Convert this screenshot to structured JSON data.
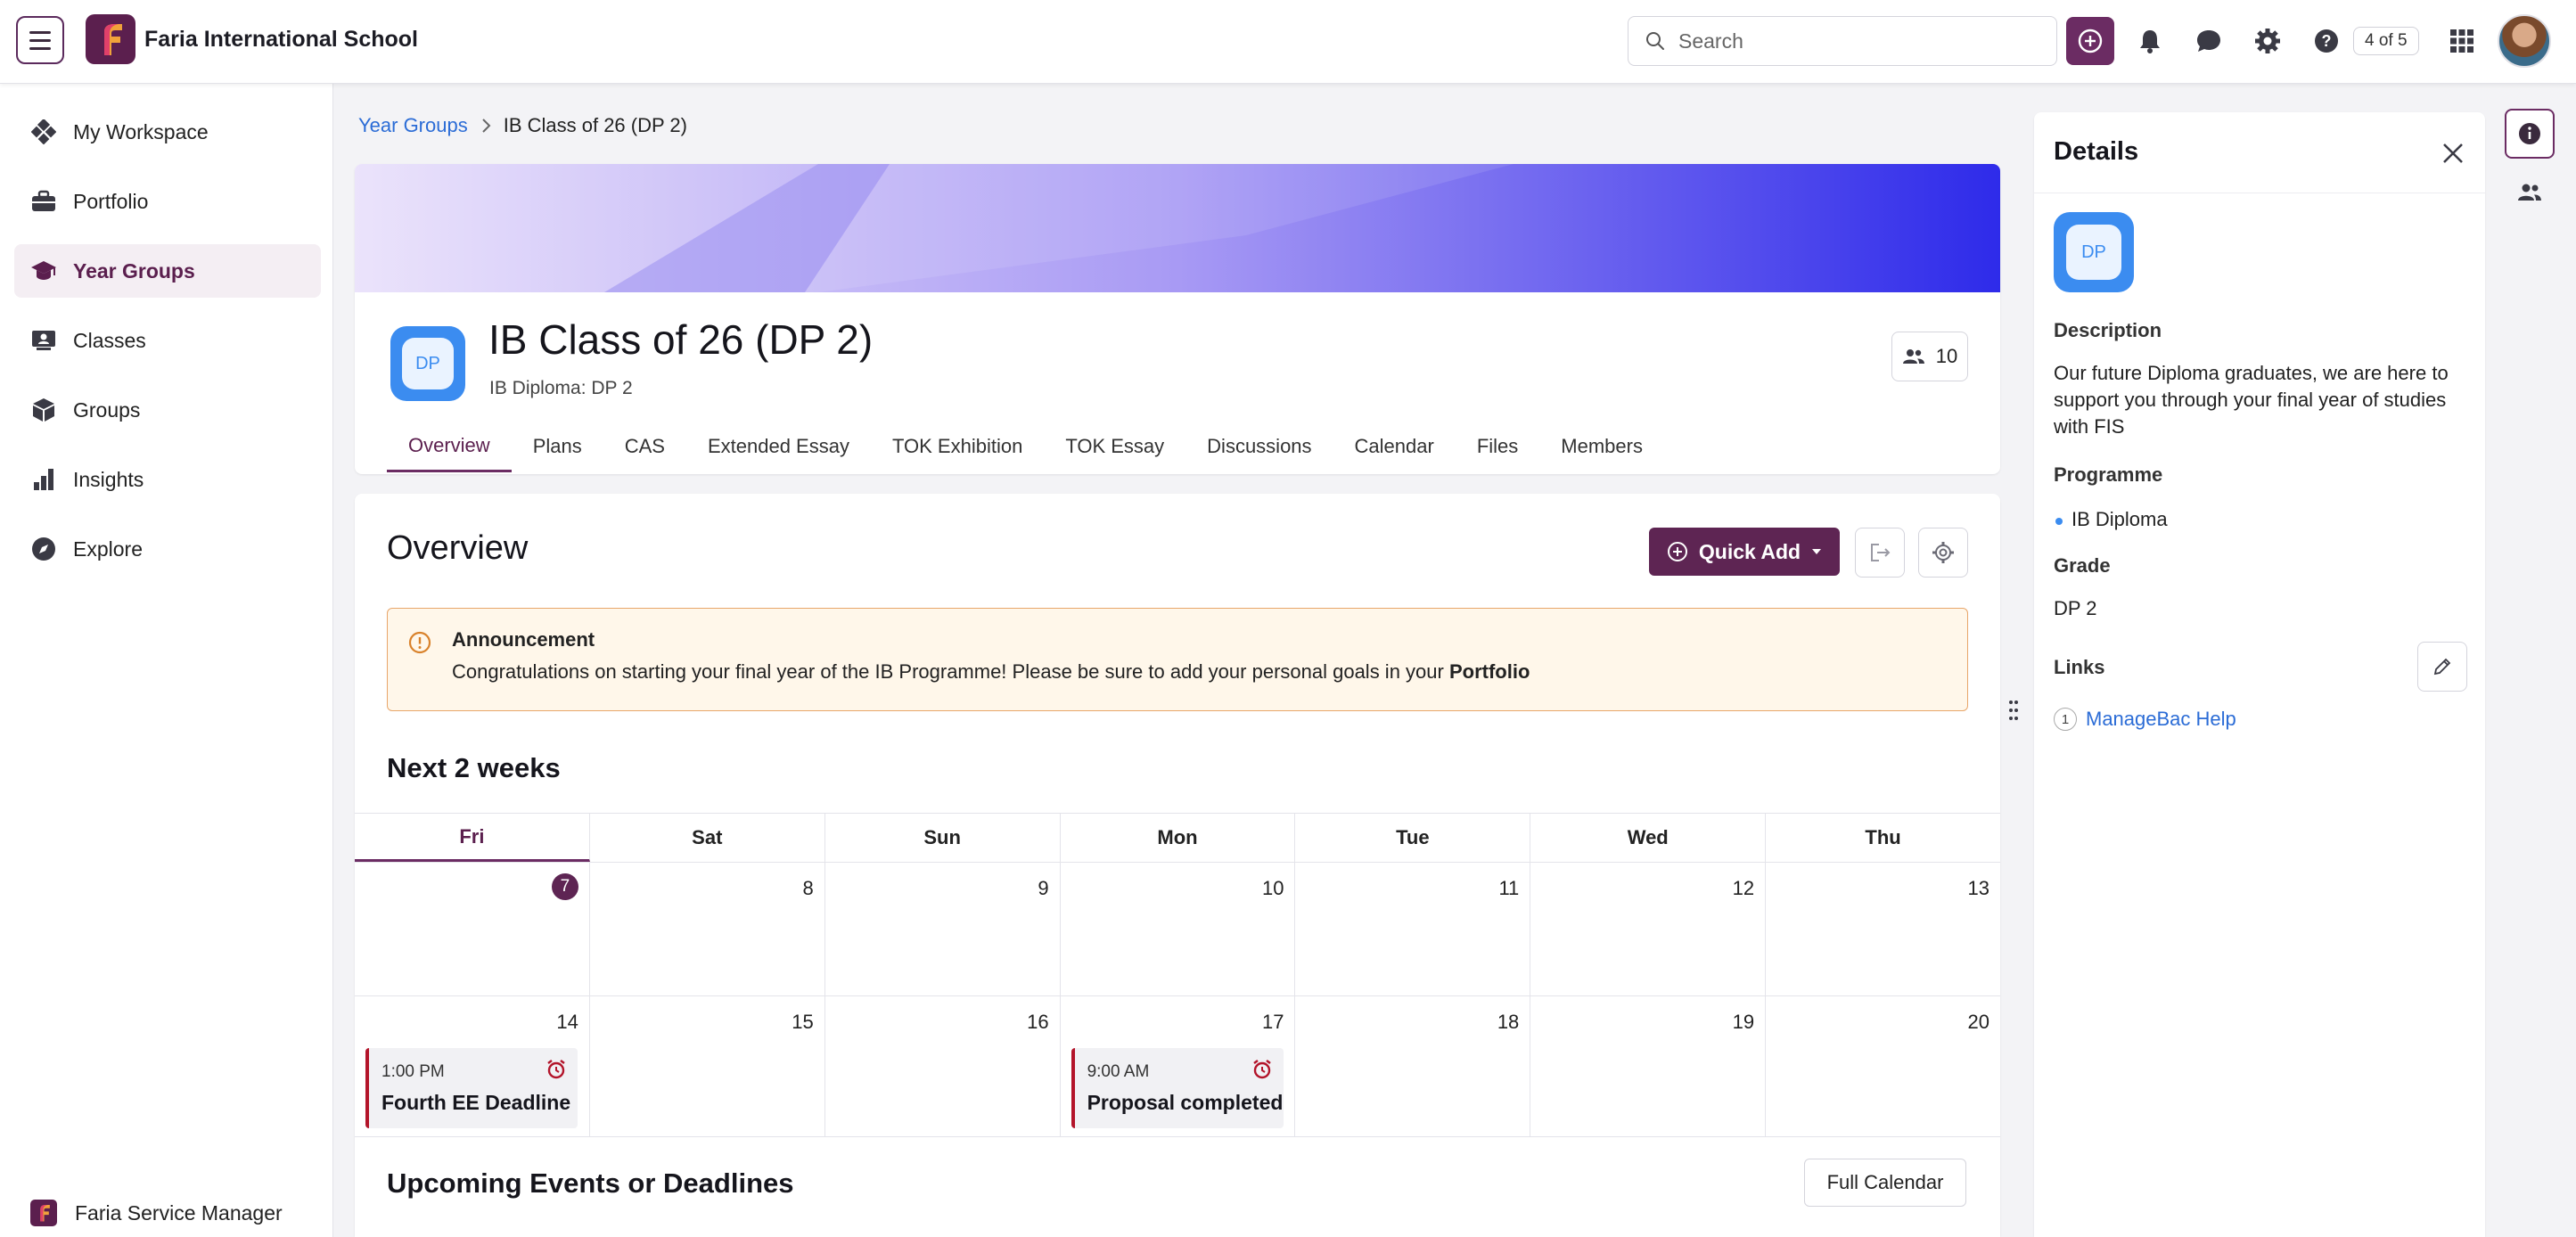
{
  "topbar": {
    "school_name": "Faria International School",
    "search_placeholder": "Search",
    "pager": "4 of 5"
  },
  "sidebar": {
    "items": [
      {
        "label": "My Workspace",
        "icon": "workspace-icon"
      },
      {
        "label": "Portfolio",
        "icon": "briefcase-icon"
      },
      {
        "label": "Year Groups",
        "icon": "graduation-cap-icon",
        "active": true
      },
      {
        "label": "Classes",
        "icon": "classes-icon"
      },
      {
        "label": "Groups",
        "icon": "cube-icon"
      },
      {
        "label": "Insights",
        "icon": "bar-chart-icon"
      },
      {
        "label": "Explore",
        "icon": "compass-icon"
      }
    ],
    "footer_label": "Faria Service Manager"
  },
  "breadcrumb": {
    "parent": "Year Groups",
    "current": "IB Class of 26 (DP 2)"
  },
  "header": {
    "badge": "DP",
    "title": "IB Class of 26 (DP 2)",
    "subtitle": "IB Diploma: DP 2",
    "member_count": "10",
    "tabs": [
      "Overview",
      "Plans",
      "CAS",
      "Extended Essay",
      "TOK Exhibition",
      "TOK Essay",
      "Discussions",
      "Calendar",
      "Files",
      "Members"
    ]
  },
  "overview": {
    "title": "Overview",
    "quick_add": "Quick Add",
    "announcement": {
      "title": "Announcement",
      "text": "Congratulations on starting your final year of the IB Programme! Please be sure to add your personal goals in your ",
      "bold": "Portfolio"
    },
    "next_title": "Next 2 weeks",
    "weekdays": [
      "Fri",
      "Sat",
      "Sun",
      "Mon",
      "Tue",
      "Wed",
      "Thu"
    ],
    "week1": [
      "7",
      "8",
      "9",
      "10",
      "11",
      "12",
      "13"
    ],
    "week2": [
      "14",
      "15",
      "16",
      "17",
      "18",
      "19",
      "20"
    ],
    "events": [
      {
        "time": "1:00 PM",
        "title": "Fourth EE Deadline"
      },
      {
        "time": "9:00 AM",
        "title": "Proposal completed"
      }
    ],
    "upcoming_title": "Upcoming Events or Deadlines",
    "full_calendar": "Full Calendar"
  },
  "details": {
    "title": "Details",
    "badge": "DP",
    "description_label": "Description",
    "description": "Our future Diploma graduates, we are here to support you through your final year of studies with FIS",
    "programme_label": "Programme",
    "programme": "IB Diploma",
    "grade_label": "Grade",
    "grade": "DP 2",
    "links_label": "Links",
    "link_num": "1",
    "link_text": "ManageBac Help"
  },
  "colors": {
    "brand": "#5e2553",
    "link": "#2b6cd6",
    "event_accent": "#b3142a",
    "announcement_border": "#e8a66a",
    "badge_blue": "#3b8cf0"
  }
}
